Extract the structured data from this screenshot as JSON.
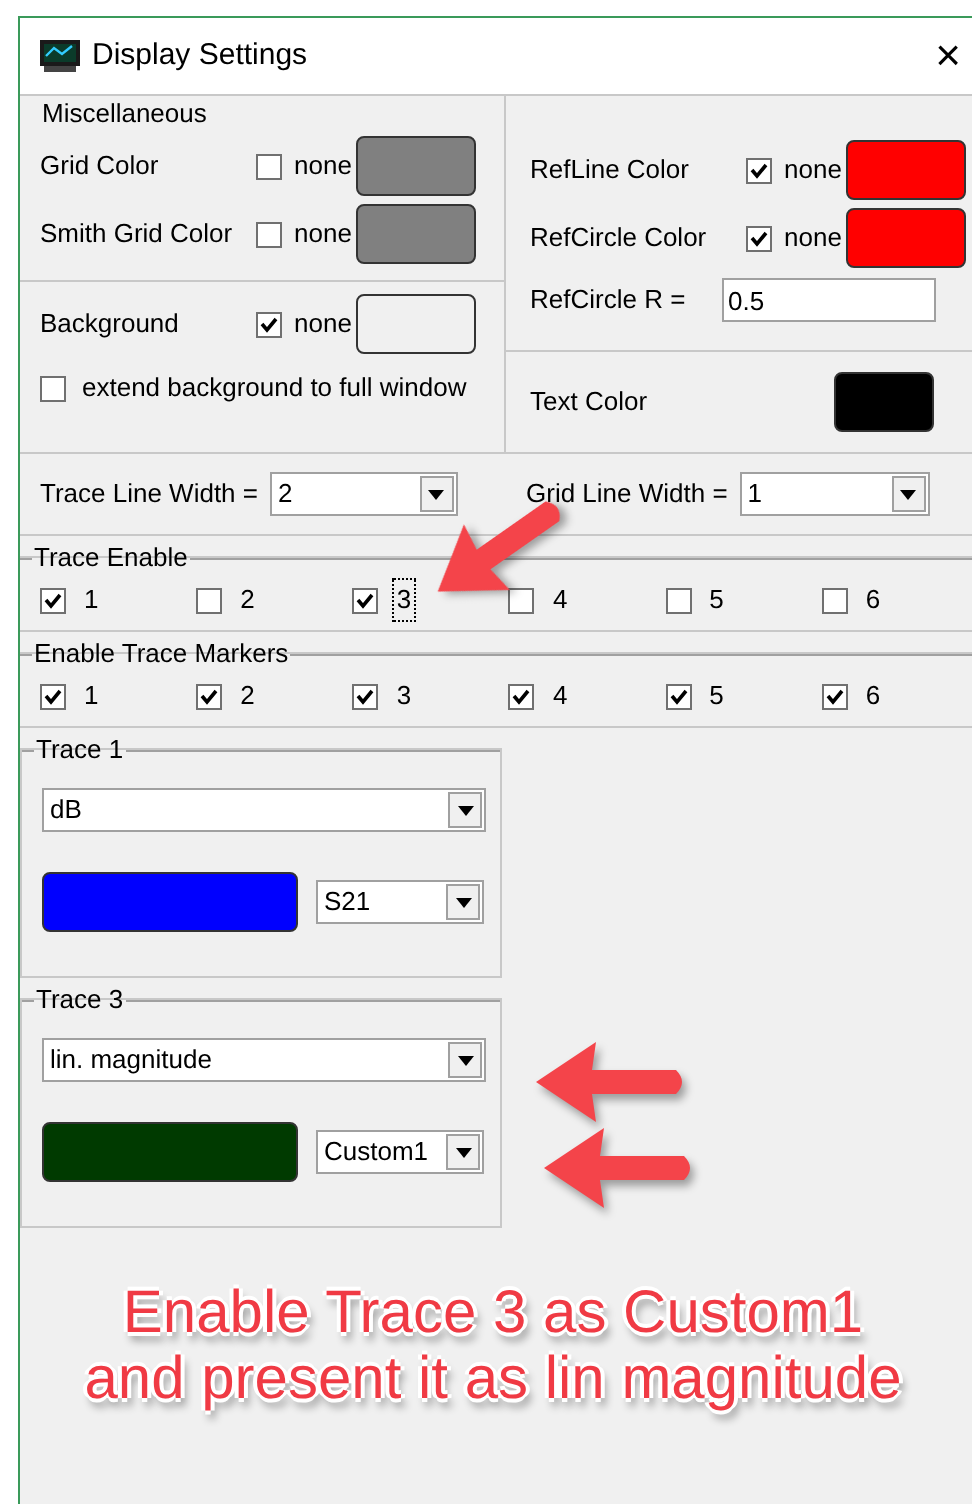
{
  "window": {
    "title": "Display Settings",
    "close": "×"
  },
  "miscellaneous": {
    "title": "Miscellaneous",
    "colors": [
      {
        "label": "Grid Color",
        "none_label": "none",
        "checked": false,
        "color": "#808080"
      },
      {
        "label": "Smith Grid Color",
        "none_label": "none",
        "checked": false,
        "color": "#808080"
      }
    ],
    "background": {
      "label": "Background",
      "none_label": "none",
      "checked": true,
      "color": "#f0f0f0"
    },
    "extend": {
      "label": "extend background to full window",
      "checked": false
    },
    "ref_colors": [
      {
        "label": "RefLine Color",
        "none_label": "none",
        "checked": true,
        "color": "#ff0000"
      },
      {
        "label": "RefCircle Color",
        "none_label": "none",
        "checked": true,
        "color": "#ff0000"
      }
    ],
    "refcircle_r": {
      "label": "RefCircle R =",
      "value": "0.5"
    },
    "text_color": {
      "label": "Text Color",
      "color": "#000000"
    }
  },
  "widths": [
    {
      "label": "Trace Line Width =",
      "value": "2"
    },
    {
      "label": "Grid Line Width =",
      "value": "1"
    }
  ],
  "trace_enable": {
    "title": "Trace Enable",
    "items": [
      {
        "label": "1",
        "checked": true,
        "focused": false
      },
      {
        "label": "2",
        "checked": false,
        "focused": false
      },
      {
        "label": "3",
        "checked": true,
        "focused": true
      },
      {
        "label": "4",
        "checked": false,
        "focused": false
      },
      {
        "label": "5",
        "checked": false,
        "focused": false
      },
      {
        "label": "6",
        "checked": false,
        "focused": false
      }
    ]
  },
  "trace_markers": {
    "title": "Enable Trace Markers",
    "items": [
      {
        "label": "1",
        "checked": true,
        "focused": false
      },
      {
        "label": "2",
        "checked": true,
        "focused": false
      },
      {
        "label": "3",
        "checked": true,
        "focused": false
      },
      {
        "label": "4",
        "checked": true,
        "focused": false
      },
      {
        "label": "5",
        "checked": true,
        "focused": false
      },
      {
        "label": "6",
        "checked": true,
        "focused": false
      }
    ]
  },
  "traces": [
    {
      "title": "Trace 1",
      "format": "dB",
      "color": "#0000ff",
      "parameter": "S21"
    },
    {
      "title": "Trace 3",
      "format": "lin. magnitude",
      "color": "#003a00",
      "parameter": "Custom1"
    }
  ],
  "annotation": [
    "Enable Trace 3 as Custom1",
    "and present it as lin magnitude"
  ]
}
